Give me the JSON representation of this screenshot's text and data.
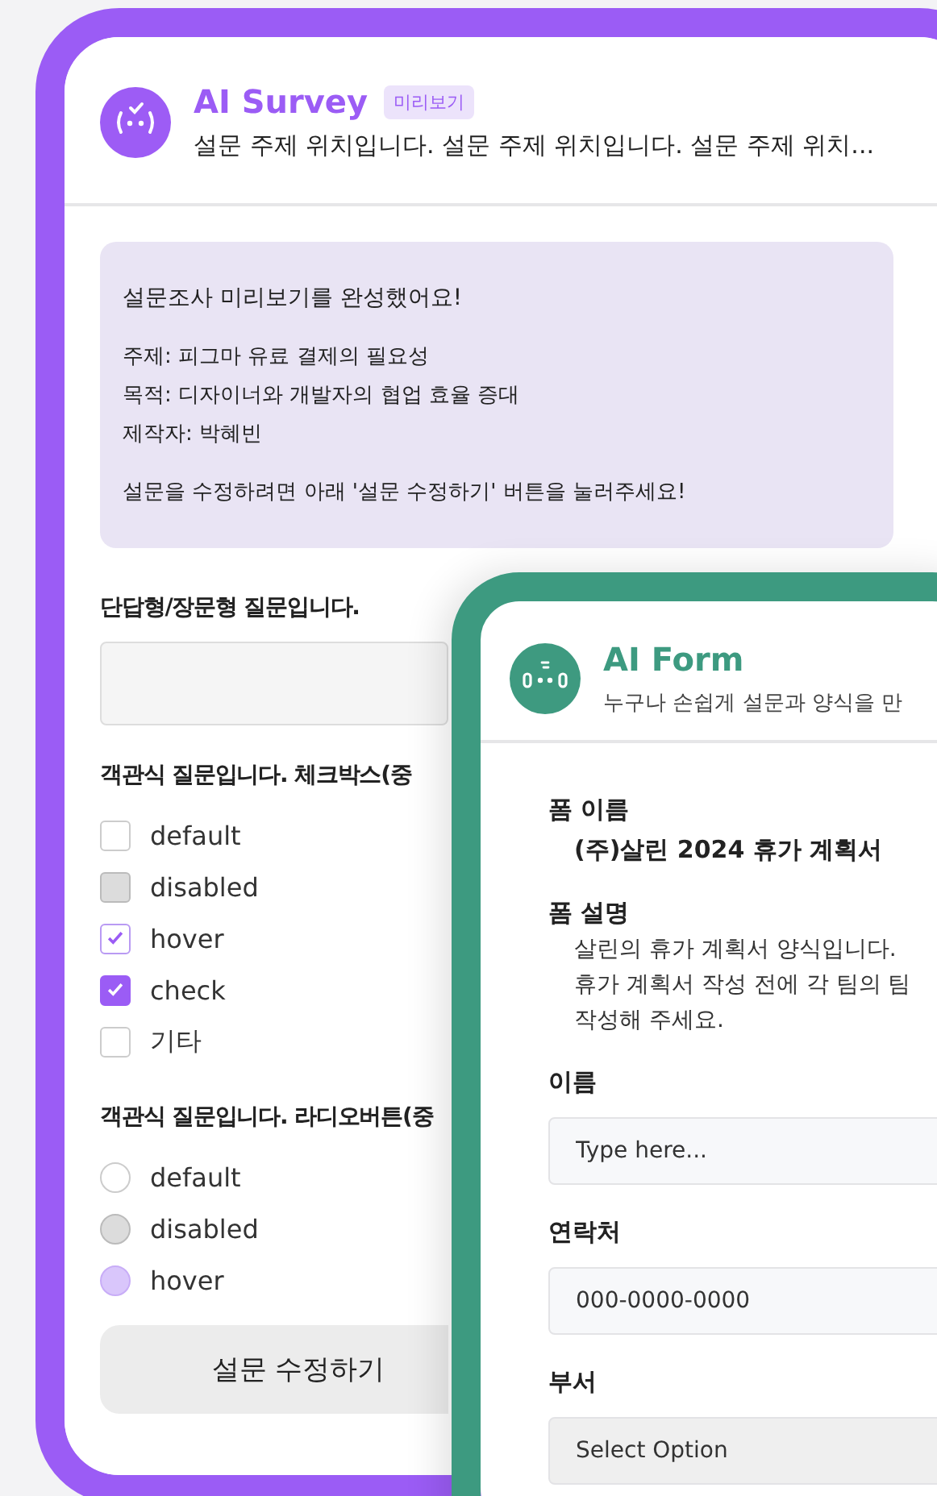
{
  "survey_window": {
    "title": "AI Survey",
    "badge": "미리보기",
    "subtitle": "설문 주제 위치입니다. 설문 주제 위치입니다. 설문 주제 위치...",
    "notice": {
      "heading": "설문조사 미리보기를 완성했어요!",
      "lines": [
        "주제: 피그마 유료 결제의 필요성",
        "목적: 디자이너와 개발자의 협업 효율 증대",
        "제작자: 박혜빈"
      ],
      "note": "설문을 수정하려면 아래 '설문 수정하기' 버튼을 눌러주세요!"
    },
    "questions": [
      {
        "kind": "text",
        "label": "단답형/장문형 질문입니다."
      },
      {
        "kind": "checkbox",
        "label": "객관식 질문입니다. 체크박스(중",
        "options": [
          {
            "kind": "normal",
            "label": "default",
            "checked": false,
            "disabled": false
          },
          {
            "kind": "normal",
            "label": "disabled",
            "checked": false,
            "disabled": true
          },
          {
            "kind": "hover",
            "label": "hover",
            "checked": true,
            "disabled": false
          },
          {
            "kind": "normal",
            "label": "check",
            "checked": true,
            "disabled": false
          },
          {
            "kind": "normal",
            "label": "기타",
            "checked": false,
            "disabled": false
          }
        ]
      },
      {
        "kind": "radio",
        "label": "객관식 질문입니다. 라디오버튼(중",
        "options": [
          {
            "kind": "normal",
            "label": "default",
            "selected": false,
            "disabled": false
          },
          {
            "kind": "normal",
            "label": "disabled",
            "selected": false,
            "disabled": true
          },
          {
            "kind": "hover",
            "label": "hover",
            "selected": false,
            "disabled": false
          }
        ]
      }
    ],
    "edit_button": "설문 수정하기"
  },
  "form_window": {
    "title": "AI Form",
    "subtitle": "누구나 손쉽게 설문과 양식을 만",
    "form_name": {
      "label": "폼 이름",
      "value": "(주)살린 2024 휴가 계획서"
    },
    "form_description": {
      "label": "폼 설명",
      "lines": [
        "살린의 휴가 계획서 양식입니다.",
        "휴가 계획서 작성 전에 각 팀의 팀",
        "작성해 주세요."
      ]
    },
    "fields": [
      {
        "kind": "input",
        "label": "이름",
        "placeholder": "Type here..."
      },
      {
        "kind": "input",
        "label": "연락처",
        "placeholder": "000-0000-0000"
      },
      {
        "kind": "select",
        "label": "부서",
        "placeholder": "Select Option"
      }
    ]
  }
}
